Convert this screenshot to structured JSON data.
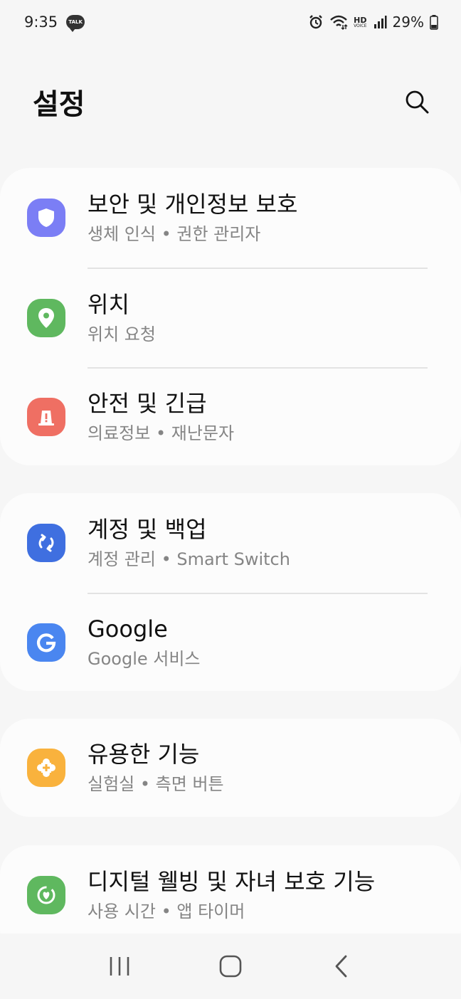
{
  "status_bar": {
    "time": "9:35",
    "notification_badge": "TALK",
    "hd": "HD",
    "voice": "VOICE",
    "battery_percent": "29%"
  },
  "header": {
    "title": "설정"
  },
  "groups": [
    {
      "items": [
        {
          "title": "보안 및 개인정보 보호",
          "subtitle": "생체 인식  •  권한 관리자",
          "icon": "shield-icon",
          "color": "#7b7ef5"
        },
        {
          "title": "위치",
          "subtitle": "위치 요청",
          "icon": "location-pin-icon",
          "color": "#5fb85f"
        },
        {
          "title": "안전 및 긴급",
          "subtitle": "의료정보  •  재난문자",
          "icon": "emergency-siren-icon",
          "color": "#ef6f63"
        }
      ]
    },
    {
      "items": [
        {
          "title": "계정 및 백업",
          "subtitle": "계정 관리  •  Smart Switch",
          "icon": "sync-icon",
          "color": "#3f6fe0"
        },
        {
          "title": "Google",
          "subtitle": "Google 서비스",
          "icon": "google-g-icon",
          "color": "#4a86f0"
        }
      ]
    },
    {
      "items": [
        {
          "title": "유용한 기능",
          "subtitle": "실험실  •  측면 버튼",
          "icon": "puzzle-plus-icon",
          "color": "#f9b23d"
        }
      ]
    },
    {
      "items": [
        {
          "title": "디지털 웰빙 및 자녀 보호 기능",
          "subtitle": "사용 시간  •  앱 타이머",
          "icon": "wellbeing-heart-icon",
          "color": "#5fb85f"
        }
      ]
    }
  ]
}
